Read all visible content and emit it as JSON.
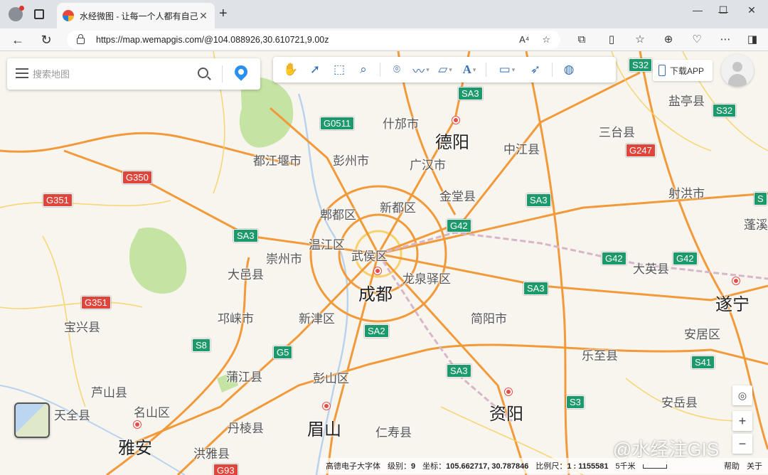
{
  "browser": {
    "tab_title": "水经微图 - 让每一个人都有自己的",
    "url": "https://map.wemapgis.com/@104.088926,30.610721,9.00z",
    "reader_icon": "A⁴",
    "icons": [
      "profile-icon",
      "tabs-icon",
      "back-icon",
      "refresh-icon",
      "lock-icon",
      "read-aloud-icon",
      "favorite-icon",
      "extensions-icon",
      "split-screen-icon",
      "favorites-icon",
      "collections-icon",
      "browser-essentials-icon",
      "more-icon",
      "sidebar-icon"
    ]
  },
  "map_ui": {
    "search_placeholder": "搜索地图",
    "download_label": "下载APP",
    "toolbar_tools": [
      "pan-tool-icon",
      "select-tool-icon",
      "box-select-icon",
      "zoom-area-icon",
      "marker-tool-icon",
      "line-tool-icon",
      "polygon-tool-icon",
      "text-tool-icon",
      "measure-tool-icon",
      "identify-tool-icon",
      "globe-icon"
    ],
    "text_tool_glyph": "A",
    "zoom_in": "+",
    "zoom_out": "−"
  },
  "status": {
    "font_name": "高德电子大字体",
    "level_label": "级别：",
    "level_value": "9",
    "coord_label": "坐标：",
    "coord_value": "105.662717, 30.787846",
    "scale_label": "比例尺：",
    "scale_value": "1 : 1155581",
    "scale_bar_label": "5千米",
    "help": "帮助",
    "about": "关于"
  },
  "watermark": "@水经注GIS",
  "labels": {
    "big": [
      "德阳",
      "成都",
      "眉山",
      "资阳",
      "遂宁",
      "雅安"
    ],
    "mid": [
      "什邡市",
      "中江县",
      "盐亭县",
      "三台县",
      "都江堰市",
      "彭州市",
      "广汉市",
      "射洪市",
      "金堂县",
      "新都区",
      "郫都区",
      "蓬溪",
      "温江区",
      "武侯区",
      "崇州市",
      "大邑县",
      "大英县",
      "龙泉驿区",
      "邛崃市",
      "新津区",
      "简阳市",
      "安居区",
      "宝兴县",
      "乐至县",
      "蒲江县",
      "彭山区",
      "芦山县",
      "天全县",
      "名山区",
      "安岳县",
      "丹棱县",
      "仁寿县",
      "洪雅县"
    ]
  },
  "shields": {
    "green": [
      "S32",
      "SA3",
      "G0511",
      "SA3",
      "S32",
      "G42",
      "SA3",
      "G42",
      "G42",
      "SA3",
      "SA2",
      "S8",
      "G5",
      "SA3",
      "S41",
      "S3",
      "S"
    ],
    "red": [
      "G247",
      "G350",
      "G351",
      "G351",
      "G93"
    ]
  },
  "colors": {
    "expressway": "#f29a3a",
    "highway_shield_green": "#1d9a6c",
    "highway_shield_red": "#e0453c",
    "park_green": "#c5e3a2",
    "map_bg": "#f8f5ee"
  }
}
